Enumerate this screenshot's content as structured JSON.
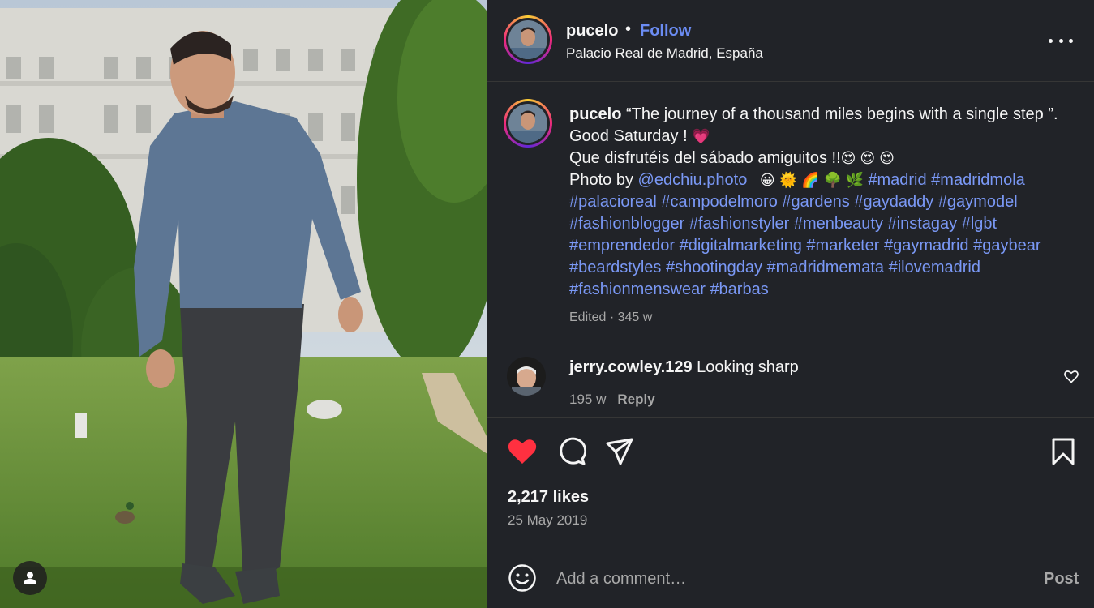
{
  "post": {
    "username": "pucelo",
    "separator": "•",
    "follow_label": "Follow",
    "location": "Palacio Real de Madrid, España"
  },
  "caption": {
    "username": "pucelo",
    "line1": " “The journey of a thousand miles begins with a single step ”. Good Saturday ! ",
    "line2": "Que disfrutéis del sábado amiguitos !!",
    "photo_by": "Photo by ",
    "mention": "@edchiu.photo",
    "hashtags": [
      "#madrid",
      "#madridmola",
      "#palacioreal",
      "#campodelmoro",
      "#gardens",
      "#gaydaddy",
      "#gaymodel",
      "#fashionblogger",
      "#fashionstyler",
      "#menbeauty",
      "#instagay",
      "#lgbt",
      "#emprendedor",
      "#digitalmarketing",
      "#marketer",
      "#gaymadrid",
      "#gaybear",
      "#beardstyles",
      "#shootingday",
      "#madridmemata",
      "#ilovemadrid",
      "#fashionmenswear",
      "#barbas"
    ],
    "edited": "Edited · 345 w"
  },
  "comment": {
    "username": "jerry.cowley.129",
    "text": " Looking sharp",
    "age": "195 w",
    "reply_label": "Reply"
  },
  "stats": {
    "likes": "2,217 likes",
    "date": "25 May 2019"
  },
  "add_comment": {
    "placeholder": "Add a comment…",
    "post_label": "Post"
  },
  "icons": {
    "like": "heart-filled-icon",
    "comment": "comment-bubble-icon",
    "share": "paper-plane-icon",
    "save": "bookmark-icon",
    "more": "more-dots-icon",
    "emoji": "smiley-icon",
    "user_tag": "user-icon"
  },
  "colors": {
    "background": "#212328",
    "link": "#7a98f5",
    "like_red": "#ff3040",
    "muted": "#a8a8a8"
  }
}
